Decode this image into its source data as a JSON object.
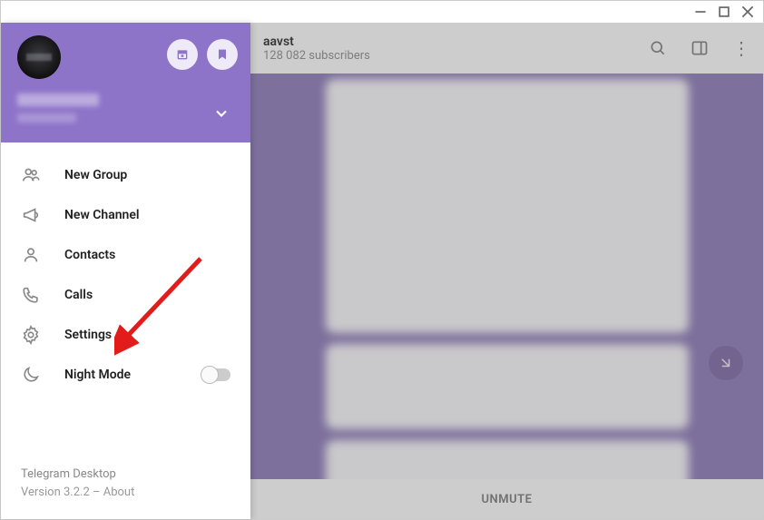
{
  "window": {
    "titlebar": {
      "min": "−",
      "max": "□",
      "close": "×"
    }
  },
  "chat": {
    "title": "aavst",
    "subscribers": "128 082 subscribers",
    "unmute": "UNMUTE"
  },
  "drawer": {
    "menu": [
      {
        "name": "new-group",
        "label": "New Group",
        "icon": "group"
      },
      {
        "name": "new-channel",
        "label": "New Channel",
        "icon": "megaphone"
      },
      {
        "name": "contacts",
        "label": "Contacts",
        "icon": "person"
      },
      {
        "name": "calls",
        "label": "Calls",
        "icon": "phone"
      },
      {
        "name": "settings",
        "label": "Settings",
        "icon": "gear"
      },
      {
        "name": "night-mode",
        "label": "Night Mode",
        "icon": "moon",
        "toggle": true
      }
    ],
    "footer": {
      "app": "Telegram Desktop",
      "version": "Version 3.2.2 – About"
    }
  }
}
